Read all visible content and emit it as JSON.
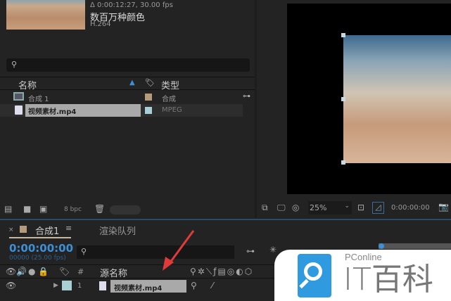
{
  "project": {
    "info_duration": "Δ 0:00:12:27, 30.00 fps",
    "info_colors": "数百万种颜色",
    "info_codec": "H.264",
    "col_name": "名称",
    "col_type": "类型",
    "items": [
      {
        "name": "合成 1",
        "type": "合成",
        "color": "#b59b7c"
      },
      {
        "name": "视频素材.mp4",
        "type": "MPEG",
        "color": "#a8d0d4"
      }
    ],
    "bpc": "8 bpc"
  },
  "viewer": {
    "zoom": "25%",
    "timecode": "0:00:00:00"
  },
  "timeline": {
    "tab_comp": "合成1",
    "tab_render": "渲染队列",
    "timecode": "0:00:00:00",
    "frames": "00000 (25.00 fps)",
    "col_num": "#",
    "col_source": "源名称",
    "layer": {
      "num": "1",
      "name": "视频素材.mp4",
      "color": "#a8d0d4"
    }
  },
  "watermark": {
    "brand": "PConline",
    "title": "IT百科"
  }
}
